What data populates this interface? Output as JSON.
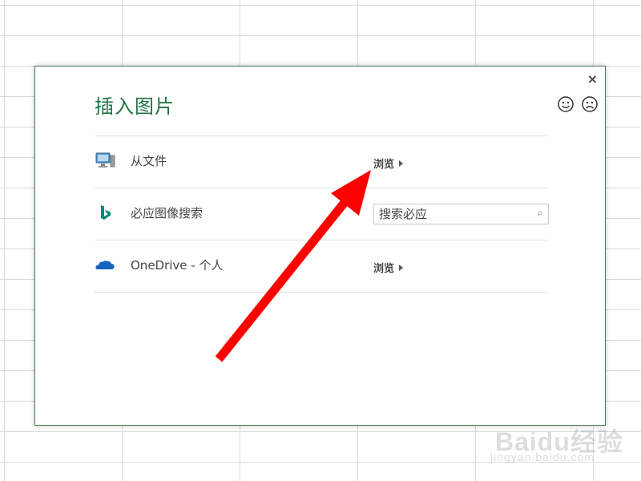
{
  "dialog": {
    "title": "插入图片",
    "close_label": "×",
    "rows": [
      {
        "label": "从文件",
        "action_label": "浏览"
      },
      {
        "label": "必应图像搜索",
        "search_placeholder": "搜索必应"
      },
      {
        "label": "OneDrive - 个人",
        "action_label": "浏览"
      }
    ]
  },
  "colors": {
    "title_green": "#217346",
    "annotation_red": "#ff0000",
    "bing_teal": "#00897b",
    "onedrive_blue": "#1565c0"
  },
  "icons": {
    "row0": "computer-icon",
    "row1": "bing-icon",
    "row2": "onedrive-cloud-icon"
  },
  "watermark": {
    "logo": "Baidu经验",
    "url": "jingyan.baidu.com"
  }
}
